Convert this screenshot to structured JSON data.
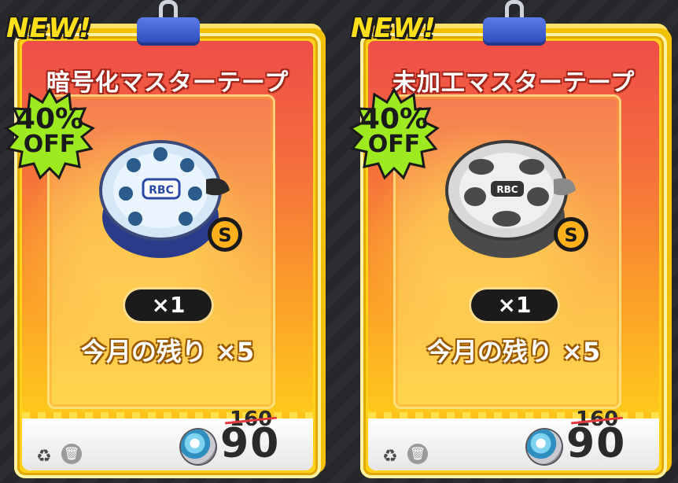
{
  "cards": [
    {
      "new_label": "NEW!",
      "title": "暗号化マスターテープ",
      "discount_pct": "40%",
      "discount_off": "OFF",
      "quantity": "×1",
      "remaining": "今月の残り ×5",
      "old_price": "160",
      "price": "90",
      "rank_badge": "S",
      "item_icon": "encrypted-master-tape-reel",
      "tape_label": "RBC"
    },
    {
      "new_label": "NEW!",
      "title": "未加工マスターテープ",
      "discount_pct": "40%",
      "discount_off": "OFF",
      "quantity": "×1",
      "remaining": "今月の残り ×5",
      "old_price": "160",
      "price": "90",
      "rank_badge": "S",
      "item_icon": "raw-master-tape-reel",
      "tape_label": "RBC"
    }
  ],
  "colors": {
    "card_frame": "#ffd21a",
    "card_face_top": "#ef4d48",
    "badge_green": "#9cea1f",
    "old_price_strike": "#e23b3b",
    "new_label": "#ffe01a"
  }
}
